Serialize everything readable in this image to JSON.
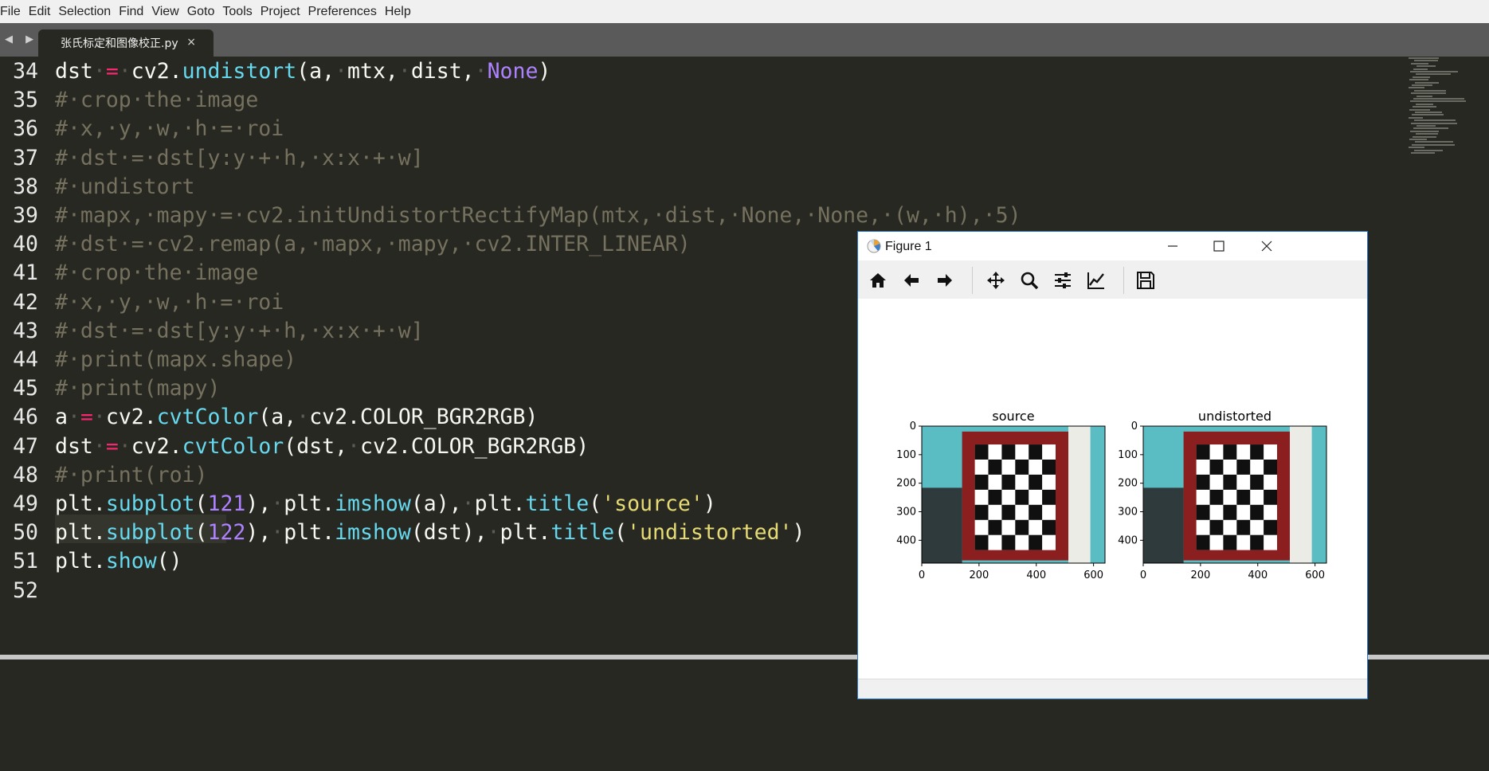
{
  "menu": [
    "File",
    "Edit",
    "Selection",
    "Find",
    "View",
    "Goto",
    "Tools",
    "Project",
    "Preferences",
    "Help"
  ],
  "tab": {
    "filename": "张氏标定和图像校正.py",
    "close_glyph": "×",
    "nav_glyphs": "◀ ▶"
  },
  "editor": {
    "line_numbers": [
      "34",
      "35",
      "36",
      "37",
      "38",
      "39",
      "40",
      "41",
      "42",
      "43",
      "44",
      "45",
      "46",
      "47",
      "48",
      "49",
      "50",
      "51",
      "52"
    ],
    "lines": [
      [
        [
          "dst",
          ""
        ],
        [
          "·",
          "dot"
        ],
        [
          "=",
          "kw"
        ],
        [
          "·",
          "dot"
        ],
        [
          "cv2.",
          ""
        ],
        [
          "undistort",
          "fn"
        ],
        [
          "(a,",
          ""
        ],
        [
          "·",
          "dot"
        ],
        [
          "mtx,",
          ""
        ],
        [
          "·",
          "dot"
        ],
        [
          "dist,",
          ""
        ],
        [
          "·",
          "dot"
        ],
        [
          "None",
          "num"
        ],
        [
          ")",
          ""
        ]
      ],
      [
        [
          "#·crop·the·image",
          "cmt"
        ]
      ],
      [
        [
          "#·x,·y,·w,·h·=·roi",
          "cmt"
        ]
      ],
      [
        [
          "#·dst·=·dst[y:y·+·h,·x:x·+·w]",
          "cmt"
        ]
      ],
      [
        [
          "#·undistort",
          "cmt"
        ]
      ],
      [
        [
          "#·mapx,·mapy·=·cv2.initUndistortRectifyMap(mtx,·dist,·None,·None,·(w,·h),·5)",
          "cmt"
        ]
      ],
      [
        [
          "#·dst·=·cv2.remap(a,·mapx,·mapy,·cv2.INTER_LINEAR)",
          "cmt"
        ]
      ],
      [
        [
          "#·crop·the·image",
          "cmt"
        ]
      ],
      [
        [
          "#·x,·y,·w,·h·=·roi",
          "cmt"
        ]
      ],
      [
        [
          "#·dst·=·dst[y:y·+·h,·x:x·+·w]",
          "cmt"
        ]
      ],
      [
        [
          "#·print(mapx.shape)",
          "cmt"
        ]
      ],
      [
        [
          "#·print(mapy)",
          "cmt"
        ]
      ],
      [
        [
          "a",
          ""
        ],
        [
          "·",
          "dot"
        ],
        [
          "=",
          "kw"
        ],
        [
          "·",
          "dot"
        ],
        [
          "cv2.",
          ""
        ],
        [
          "cvtColor",
          "fn"
        ],
        [
          "(a,",
          ""
        ],
        [
          "·",
          "dot"
        ],
        [
          "cv2.COLOR_BGR2RGB)",
          ""
        ]
      ],
      [
        [
          "dst",
          ""
        ],
        [
          "·",
          "dot"
        ],
        [
          "=",
          "kw"
        ],
        [
          "·",
          "dot"
        ],
        [
          "cv2.",
          ""
        ],
        [
          "cvtColor",
          "fn"
        ],
        [
          "(dst,",
          ""
        ],
        [
          "·",
          "dot"
        ],
        [
          "cv2.COLOR_BGR2RGB)",
          ""
        ]
      ],
      [
        [
          "#·print(roi)",
          "cmt"
        ]
      ],
      [
        [
          "plt.",
          ""
        ],
        [
          "subplot",
          "fn"
        ],
        [
          "(",
          ""
        ],
        [
          "121",
          "num"
        ],
        [
          "),",
          ""
        ],
        [
          "·",
          "dot"
        ],
        [
          "plt.",
          ""
        ],
        [
          "imshow",
          "fn"
        ],
        [
          "(a),",
          ""
        ],
        [
          "·",
          "dot"
        ],
        [
          "plt.",
          ""
        ],
        [
          "title",
          "fn"
        ],
        [
          "(",
          ""
        ],
        [
          "'source'",
          "str"
        ],
        [
          ")",
          ""
        ]
      ],
      [
        [
          "plt.",
          ""
        ],
        [
          "subplot",
          "fn"
        ],
        [
          "(",
          ""
        ],
        [
          "122",
          "num"
        ],
        [
          "),",
          ""
        ],
        [
          "·",
          "dot"
        ],
        [
          "plt.",
          ""
        ],
        [
          "imshow",
          "fn"
        ],
        [
          "(dst),",
          ""
        ],
        [
          "·",
          "dot"
        ],
        [
          "plt.",
          ""
        ],
        [
          "title",
          "fn"
        ],
        [
          "(",
          ""
        ],
        [
          "'undistorted'",
          "str"
        ],
        [
          ")",
          ""
        ]
      ],
      [
        [
          "plt.",
          ""
        ],
        [
          "show",
          "fn"
        ],
        [
          "()",
          ""
        ]
      ],
      []
    ]
  },
  "figure": {
    "window_title": "Figure 1",
    "toolbar_icons": [
      "home-icon",
      "back-arrow-icon",
      "forward-arrow-icon",
      "pan-icon",
      "zoom-icon",
      "subplots-config-icon",
      "edit-axes-icon",
      "save-icon"
    ]
  },
  "chart_data": [
    {
      "type": "image",
      "title": "source",
      "xlim": [
        0,
        640
      ],
      "ylim": [
        480,
        0
      ],
      "xticks": [
        0,
        200,
        400,
        600
      ],
      "yticks": [
        0,
        100,
        200,
        300,
        400
      ],
      "checkerboard": {
        "rows": 6,
        "cols": 5
      }
    },
    {
      "type": "image",
      "title": "undistorted",
      "xlim": [
        0,
        640
      ],
      "ylim": [
        480,
        0
      ],
      "xticks": [
        0,
        200,
        400,
        600
      ],
      "yticks": [
        0,
        100,
        200,
        300,
        400
      ],
      "checkerboard": {
        "rows": 6,
        "cols": 5
      }
    }
  ],
  "colors": {
    "editor_bg": "#272822",
    "comment": "#75715e",
    "keyword": "#f92672",
    "function": "#66d9ef",
    "number": "#ae81ff",
    "string": "#e6db74",
    "board_red": "#8b1e1e",
    "teal_bg": "#4fb8c0"
  }
}
